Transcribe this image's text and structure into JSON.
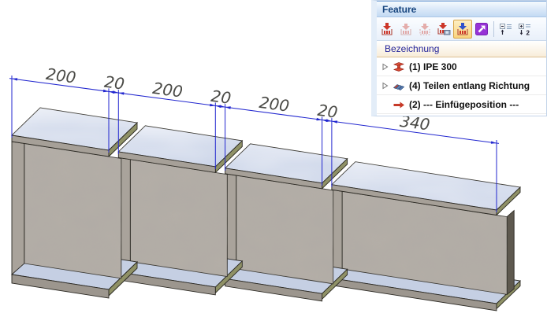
{
  "panel": {
    "title": "Feature",
    "toolbar": {
      "buttons": [
        {
          "icon": "insert-feature-icon",
          "state": "enabled"
        },
        {
          "icon": "insert-feature-into-icon",
          "state": "disabled"
        },
        {
          "icon": "insert-feature-placeholder-icon",
          "state": "disabled"
        },
        {
          "icon": "recalculate-feature-icon",
          "state": "enabled"
        },
        {
          "icon": "insert-feature-active-icon",
          "state": "selected"
        },
        {
          "icon": "jump-to-feature-icon",
          "state": "enabled"
        },
        {
          "icon": "collapse-tree-icon",
          "state": "enabled"
        },
        {
          "icon": "expand-tree-levels-icon",
          "state": "enabled"
        }
      ]
    },
    "tree_header": "Bezeichnung",
    "tree": [
      {
        "label": "(1) IPE 300",
        "icon": "steel-profile-icon",
        "expandable": true
      },
      {
        "label": "(4) Teilen entlang Richtung",
        "icon": "divide-along-direction-icon",
        "expandable": true
      },
      {
        "label": "(2) --- Einfügeposition ---",
        "icon": "insert-position-arrow-icon",
        "expandable": false
      }
    ]
  },
  "viewport": {
    "part_name": "IPE 300",
    "dimension_labels": [
      "200",
      "20",
      "200",
      "20",
      "200",
      "20",
      "340"
    ],
    "segments_mm": [
      200,
      200,
      200,
      340
    ],
    "gap_mm": 20,
    "colors": {
      "dimension": "#2126cf",
      "flange_top_light": "#e0e6f2",
      "flange_top_dark": "#c9d3e7",
      "flange_bottom": "#c5cfe3",
      "flange_edge": "#a6a098",
      "web": "#b4aea7",
      "cut_face": "#8f9166",
      "outline": "#2b2923"
    }
  }
}
